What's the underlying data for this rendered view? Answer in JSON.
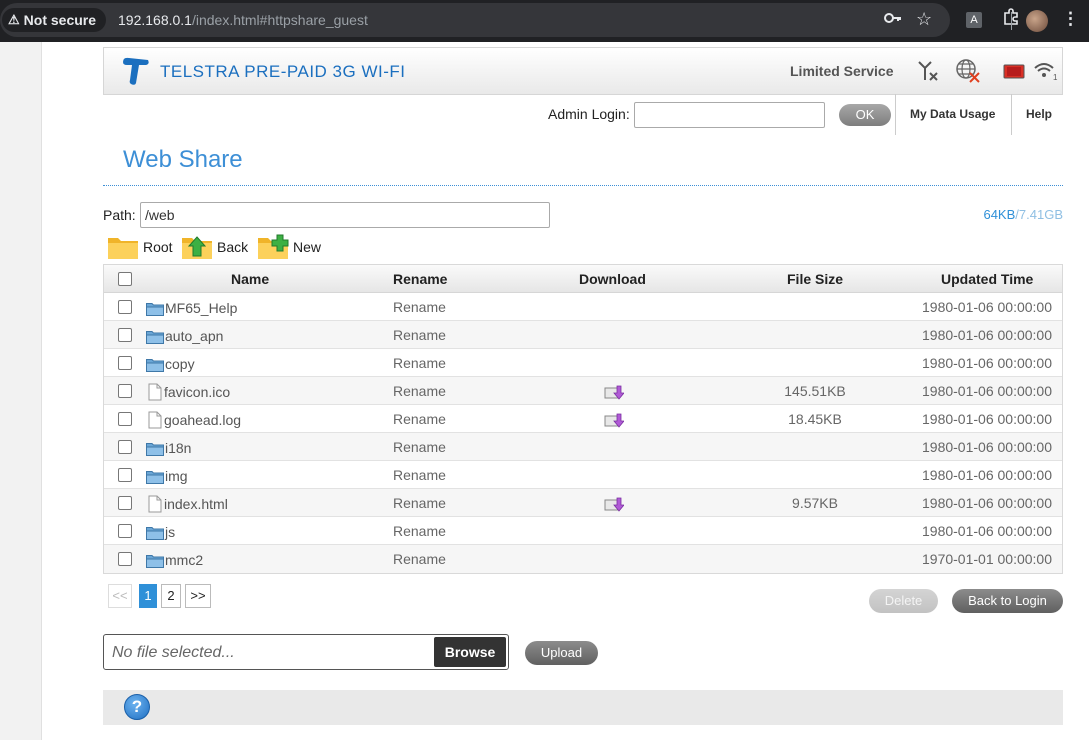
{
  "browser": {
    "security_label": "Not secure",
    "url_host": "192.168.0.1",
    "url_rest": "/index.html#httpshare_guest",
    "ext_letter": "A"
  },
  "header": {
    "brand": "TELSTRA PRE-PAID 3G WI-FI",
    "service_status": "Limited Service",
    "brand_color": "#1b6fbf"
  },
  "admin": {
    "label": "Admin Login:",
    "value": "",
    "ok_label": "OK",
    "my_data_usage": "My Data Usage",
    "help": "Help"
  },
  "page": {
    "title": "Web Share",
    "path_label": "Path:",
    "path_value": "/web",
    "used": "64KB",
    "separator": "/",
    "total": "7.41GB"
  },
  "nav": {
    "root": "Root",
    "back": "Back",
    "new": "New"
  },
  "table": {
    "headers": {
      "name": "Name",
      "rename": "Rename",
      "download": "Download",
      "size": "File Size",
      "updated": "Updated Time"
    },
    "rows": [
      {
        "type": "folder",
        "name": "MF65_Help",
        "rename": "Rename",
        "size": "",
        "updated": "1980-01-06 00:00:00",
        "download": false
      },
      {
        "type": "folder",
        "name": "auto_apn",
        "rename": "Rename",
        "size": "",
        "updated": "1980-01-06 00:00:00",
        "download": false
      },
      {
        "type": "folder",
        "name": "copy",
        "rename": "Rename",
        "size": "",
        "updated": "1980-01-06 00:00:00",
        "download": false
      },
      {
        "type": "file",
        "name": "favicon.ico",
        "rename": "Rename",
        "size": "145.51KB",
        "updated": "1980-01-06 00:00:00",
        "download": true
      },
      {
        "type": "file",
        "name": "goahead.log",
        "rename": "Rename",
        "size": "18.45KB",
        "updated": "1980-01-06 00:00:00",
        "download": true
      },
      {
        "type": "folder",
        "name": "i18n",
        "rename": "Rename",
        "size": "",
        "updated": "1980-01-06 00:00:00",
        "download": false
      },
      {
        "type": "folder",
        "name": "img",
        "rename": "Rename",
        "size": "",
        "updated": "1980-01-06 00:00:00",
        "download": false
      },
      {
        "type": "file",
        "name": "index.html",
        "rename": "Rename",
        "size": "9.57KB",
        "updated": "1980-01-06 00:00:00",
        "download": true
      },
      {
        "type": "folder",
        "name": "js",
        "rename": "Rename",
        "size": "",
        "updated": "1980-01-06 00:00:00",
        "download": false
      },
      {
        "type": "folder",
        "name": "mmc2",
        "rename": "Rename",
        "size": "",
        "updated": "1970-01-01 00:00:00",
        "download": false
      }
    ]
  },
  "pagination": {
    "prev": "<<",
    "pages": [
      "1",
      "2"
    ],
    "current": "1",
    "next": ">>"
  },
  "actions": {
    "delete": "Delete",
    "back_to_login": "Back to Login",
    "file_placeholder": "No file selected...",
    "browse": "Browse",
    "upload": "Upload"
  },
  "footer": {
    "help_glyph": "?"
  }
}
